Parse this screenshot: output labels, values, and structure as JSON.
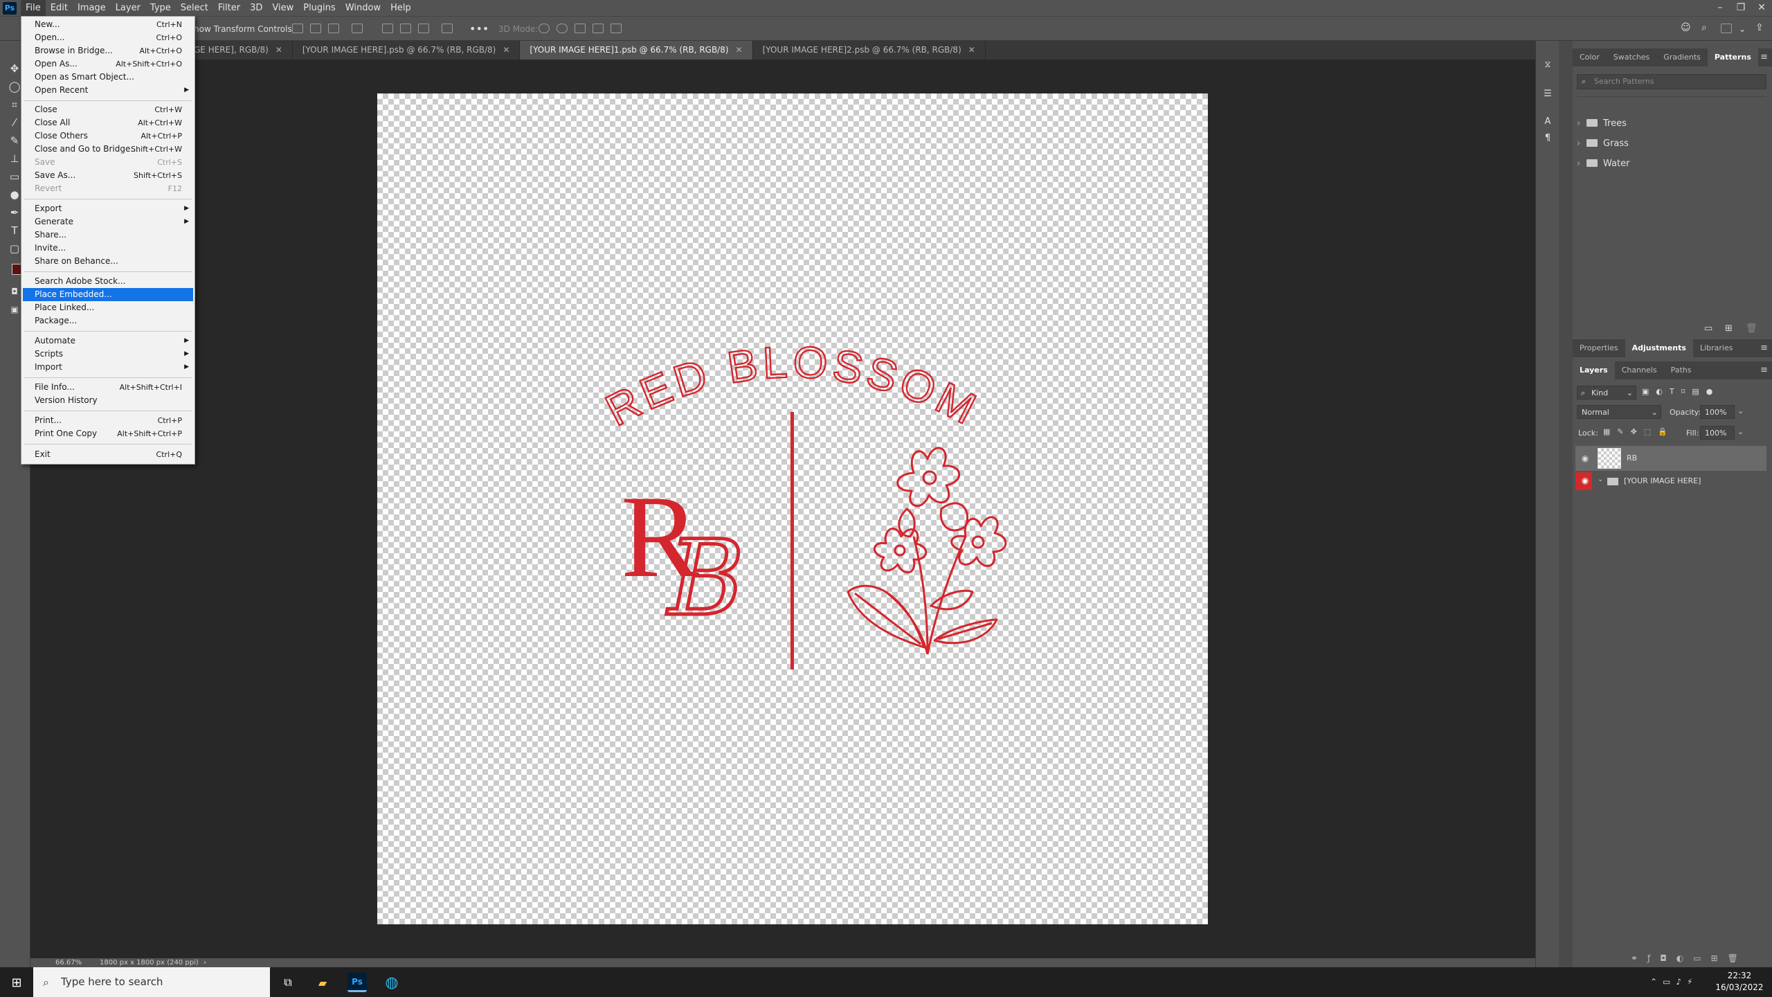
{
  "menubar": {
    "items": [
      "File",
      "Edit",
      "Image",
      "Layer",
      "Type",
      "Select",
      "Filter",
      "3D",
      "View",
      "Plugins",
      "Window",
      "Help"
    ]
  },
  "options": {
    "transform_label": "how Transform Controls",
    "mode3d_label": "3D Mode:"
  },
  "tabs": [
    {
      "label": "GE HERE], RGB/8)",
      "active": false
    },
    {
      "label": "[YOUR IMAGE HERE].psb @ 66.7% (RB, RGB/8)",
      "active": false
    },
    {
      "label": "[YOUR IMAGE HERE]1.psb @ 66.7% (RB, RGB/8)",
      "active": true
    },
    {
      "label": "[YOUR IMAGE HERE]2.psb @ 66.7% (RB, RGB/8)",
      "active": false
    }
  ],
  "file_menu": {
    "items": [
      {
        "label": "New...",
        "shortcut": "Ctrl+N"
      },
      {
        "label": "Open...",
        "shortcut": "Ctrl+O"
      },
      {
        "label": "Browse in Bridge...",
        "shortcut": "Alt+Ctrl+O"
      },
      {
        "label": "Open As...",
        "shortcut": "Alt+Shift+Ctrl+O"
      },
      {
        "label": "Open as Smart Object...",
        "shortcut": ""
      },
      {
        "label": "Open Recent",
        "shortcut": ""
      },
      {
        "label": "Close",
        "shortcut": "Ctrl+W"
      },
      {
        "label": "Close All",
        "shortcut": "Alt+Ctrl+W"
      },
      {
        "label": "Close Others",
        "shortcut": "Alt+Ctrl+P"
      },
      {
        "label": "Close and Go to Bridge...",
        "shortcut": "Shift+Ctrl+W"
      },
      {
        "label": "Save",
        "shortcut": "Ctrl+S"
      },
      {
        "label": "Save As...",
        "shortcut": "Shift+Ctrl+S"
      },
      {
        "label": "Revert",
        "shortcut": "F12"
      },
      {
        "label": "Export",
        "shortcut": ""
      },
      {
        "label": "Generate",
        "shortcut": ""
      },
      {
        "label": "Share...",
        "shortcut": ""
      },
      {
        "label": "Invite...",
        "shortcut": ""
      },
      {
        "label": "Share on Behance...",
        "shortcut": ""
      },
      {
        "label": "Search Adobe Stock...",
        "shortcut": ""
      },
      {
        "label": "Place Embedded...",
        "shortcut": ""
      },
      {
        "label": "Place Linked...",
        "shortcut": ""
      },
      {
        "label": "Package...",
        "shortcut": ""
      },
      {
        "label": "Automate",
        "shortcut": ""
      },
      {
        "label": "Scripts",
        "shortcut": ""
      },
      {
        "label": "Import",
        "shortcut": ""
      },
      {
        "label": "File Info...",
        "shortcut": "Alt+Shift+Ctrl+I"
      },
      {
        "label": "Version History",
        "shortcut": ""
      },
      {
        "label": "Print...",
        "shortcut": "Ctrl+P"
      },
      {
        "label": "Print One Copy",
        "shortcut": "Alt+Shift+Ctrl+P"
      },
      {
        "label": "Exit",
        "shortcut": "Ctrl+Q"
      }
    ]
  },
  "canvas": {
    "logo_arc_text": "RED BLOSSOM",
    "logo_monogram_r": "R",
    "logo_monogram_b": "B",
    "logo_color": "#d4262e"
  },
  "patterns_panel": {
    "tabs": [
      "Color",
      "Swatches",
      "Gradients",
      "Patterns"
    ],
    "search_placeholder": "Search Patterns",
    "folders": [
      "Trees",
      "Grass",
      "Water"
    ]
  },
  "props_panel": {
    "tabs": [
      "Properties",
      "Adjustments",
      "Libraries"
    ]
  },
  "layers_panel": {
    "tabs": [
      "Layers",
      "Channels",
      "Paths"
    ],
    "filter_kind": "Kind",
    "blend_mode": "Normal",
    "opacity_label": "Opacity:",
    "opacity_value": "100%",
    "lock_label": "Lock:",
    "fill_label": "Fill:",
    "fill_value": "100%",
    "layers": [
      {
        "name": "RB"
      },
      {
        "name": "[YOUR IMAGE HERE]"
      }
    ]
  },
  "statusbar": {
    "zoom": "66.67%",
    "doc_info": "1800 px x 1800 px (240 ppi)"
  },
  "taskbar": {
    "search_placeholder": "Type here to search",
    "time": "22:32",
    "date": "16/03/2022"
  },
  "colors": {
    "menu_highlight": "#1473e6",
    "accent_red": "#d4262e",
    "ps_blue": "#31a8ff"
  }
}
